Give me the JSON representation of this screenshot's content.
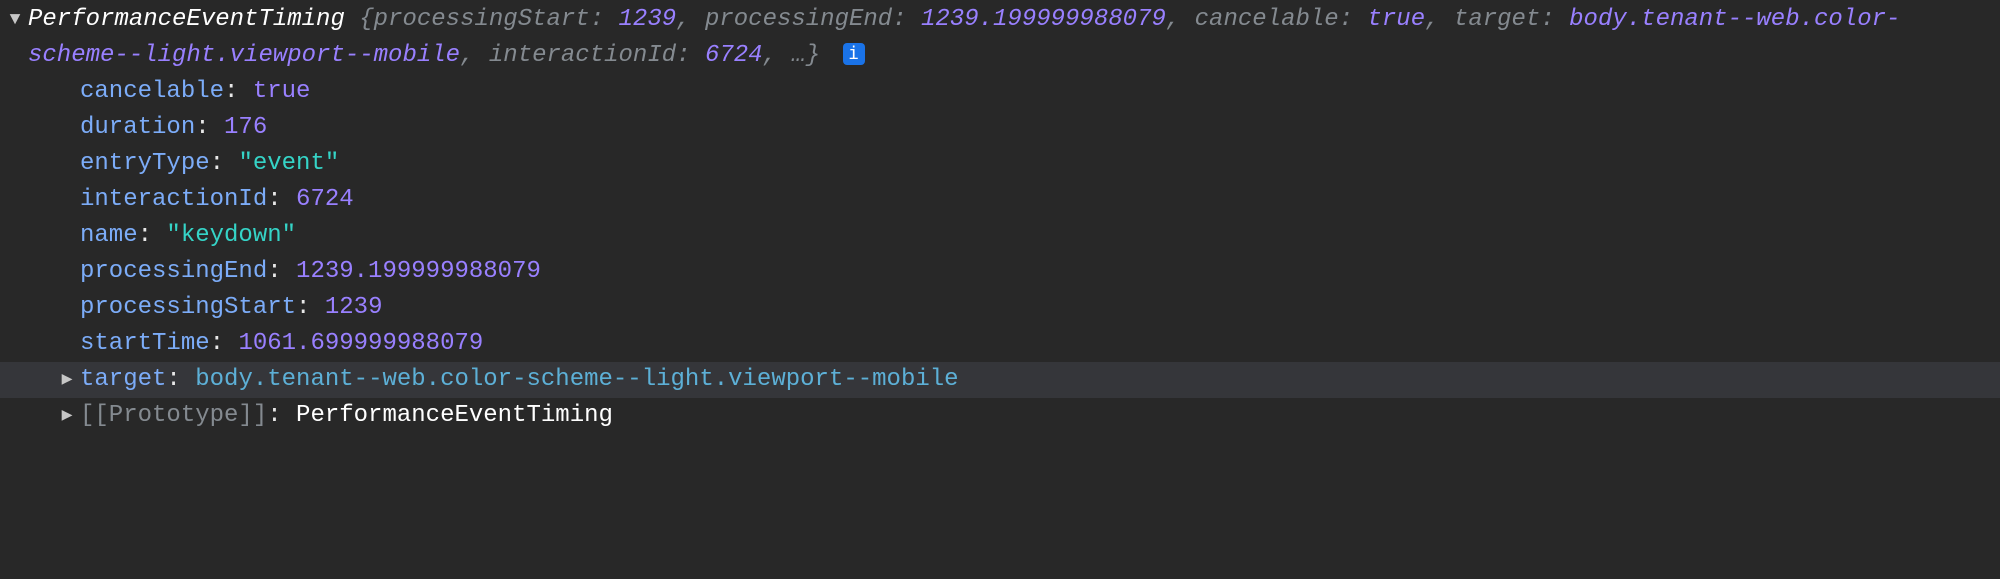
{
  "summary": {
    "className": "PerformanceEventTiming",
    "props": [
      {
        "k": "processingStart",
        "v": "1239",
        "cls": "v-num"
      },
      {
        "k": "processingEnd",
        "v": "1239.199999988079",
        "cls": "v-num"
      },
      {
        "k": "cancelable",
        "v": "true",
        "cls": "v-bool"
      },
      {
        "k": "target",
        "v": "body.tenant--web.color-scheme--light.viewport--mobile",
        "cls": "v-node"
      },
      {
        "k": "interactionId",
        "v": "6724",
        "cls": "v-num"
      }
    ],
    "ellipsis": "…",
    "infoBadge": "i"
  },
  "props": {
    "cancelable": {
      "value": "true",
      "cls": "bool"
    },
    "duration": {
      "value": "176",
      "cls": "num"
    },
    "entryType": {
      "value": "\"event\"",
      "cls": "str"
    },
    "interactionId": {
      "value": "6724",
      "cls": "num"
    },
    "name": {
      "value": "\"keydown\"",
      "cls": "str"
    },
    "processingEnd": {
      "value": "1239.199999988079",
      "cls": "num"
    },
    "processingStart": {
      "value": "1239",
      "cls": "num"
    },
    "startTime": {
      "value": "1061.699999988079",
      "cls": "num"
    }
  },
  "target": {
    "key": "target",
    "value": "body.tenant--web.color-scheme--light.viewport--mobile"
  },
  "prototype": {
    "key": "[[Prototype]]",
    "value": "PerformanceEventTiming"
  }
}
